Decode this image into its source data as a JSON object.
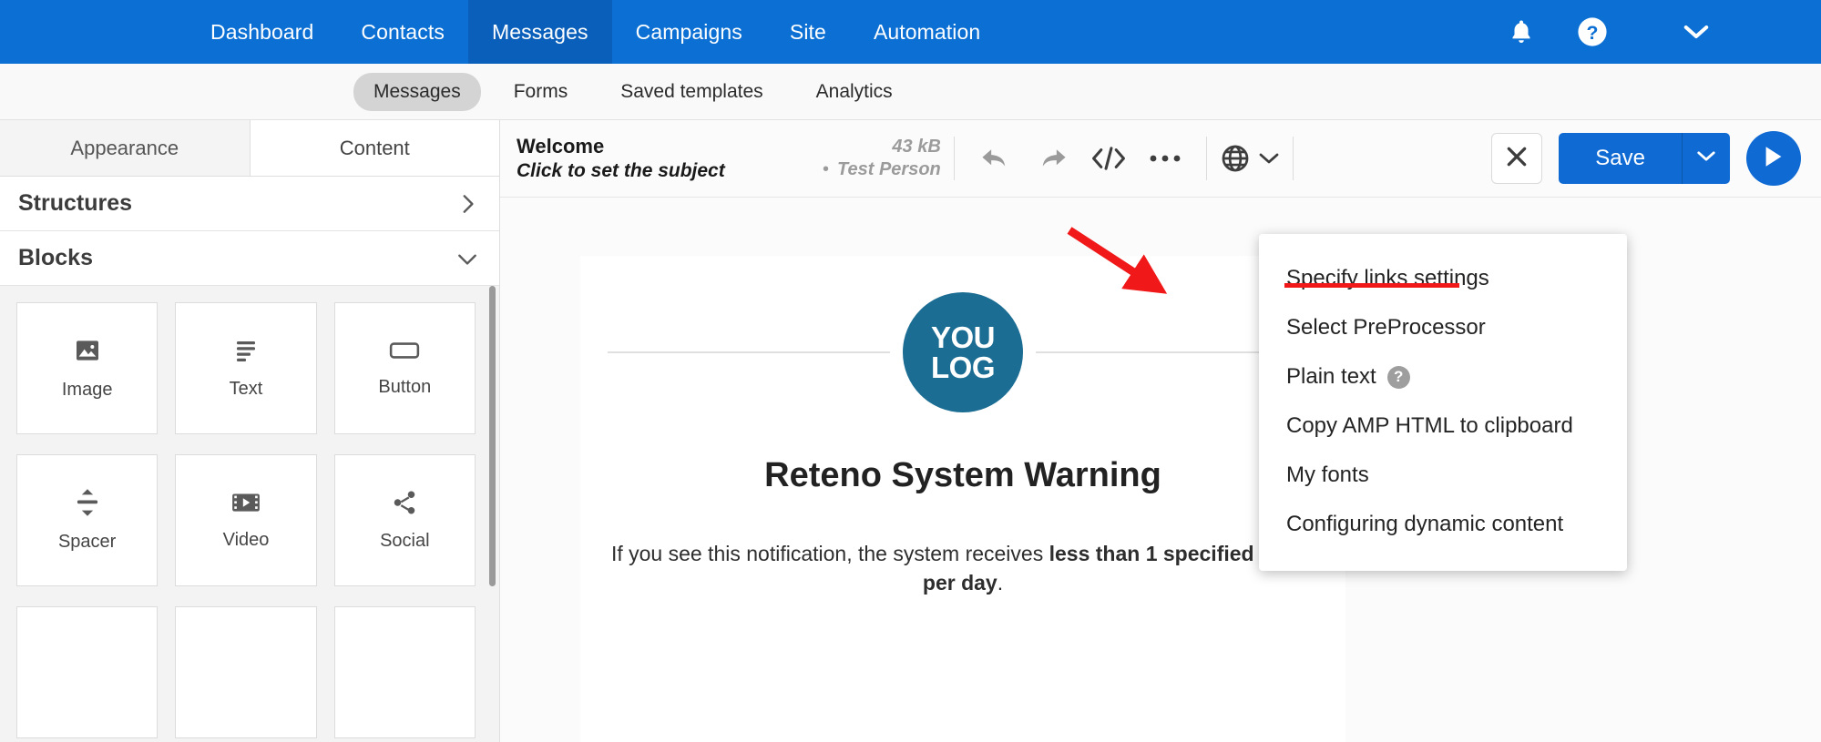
{
  "topnav": {
    "items": [
      {
        "label": "Dashboard",
        "active": false
      },
      {
        "label": "Contacts",
        "active": false
      },
      {
        "label": "Messages",
        "active": true
      },
      {
        "label": "Campaigns",
        "active": false
      },
      {
        "label": "Site",
        "active": false
      },
      {
        "label": "Automation",
        "active": false
      }
    ],
    "icons": {
      "bell": "bell-icon",
      "help": "help-circle-icon",
      "account_caret": "chevron-down-icon"
    },
    "accent_color": "#0b6fd4",
    "active_color": "#0a5fba"
  },
  "subnav": {
    "items": [
      {
        "label": "Messages",
        "active": true
      },
      {
        "label": "Forms",
        "active": false
      },
      {
        "label": "Saved templates",
        "active": false
      },
      {
        "label": "Analytics",
        "active": false
      }
    ]
  },
  "sidebar": {
    "tabs": [
      {
        "label": "Appearance",
        "active": false
      },
      {
        "label": "Content",
        "active": true
      }
    ],
    "sections": [
      {
        "label": "Structures",
        "expanded": false,
        "chevron": "chevron-right-icon"
      },
      {
        "label": "Blocks",
        "expanded": true,
        "chevron": "chevron-down-icon"
      }
    ],
    "blocks": [
      {
        "label": "Image",
        "icon": "image-icon"
      },
      {
        "label": "Text",
        "icon": "text-lines-icon"
      },
      {
        "label": "Button",
        "icon": "button-icon"
      },
      {
        "label": "Spacer",
        "icon": "spacer-arrows-icon"
      },
      {
        "label": "Video",
        "icon": "video-icon"
      },
      {
        "label": "Social",
        "icon": "share-icon"
      },
      {
        "label": "",
        "icon": ""
      },
      {
        "label": "",
        "icon": ""
      },
      {
        "label": "",
        "icon": ""
      }
    ]
  },
  "editor": {
    "subject_title": "Welcome",
    "subject_placeholder": "Click to set the subject",
    "size": "43 kB",
    "separator_dot": "•",
    "recipient": "Test Person",
    "toolbar": {
      "undo": "undo-arrow-icon",
      "redo": "redo-arrow-icon",
      "code": "code-brackets-icon",
      "more": "ellipsis-icon",
      "language": "globe-icon",
      "language_caret": "chevron-down-icon",
      "close_label": "close-icon",
      "save_label": "Save",
      "save_caret": "chevron-down-icon",
      "preview": "play-icon"
    }
  },
  "dropdown": {
    "items": [
      {
        "label": "Specify links settings",
        "highlighted": true,
        "help": false
      },
      {
        "label": "Select PreProcessor",
        "highlighted": false,
        "help": false
      },
      {
        "label": "Plain text",
        "highlighted": false,
        "help": true,
        "help_glyph": "?"
      },
      {
        "label": "Copy AMP HTML to clipboard",
        "highlighted": false,
        "help": false
      },
      {
        "label": "My fonts",
        "highlighted": false,
        "help": false
      },
      {
        "label": "Configuring dynamic content",
        "highlighted": false,
        "help": false
      }
    ],
    "annotation_color": "#f01818"
  },
  "email_preview": {
    "logo_line1": "YOU",
    "logo_line2": "LOG",
    "logo_color": "#1b6d93",
    "title": "Reteno System Warning",
    "body_prefix": "If you see this notification, the system receives ",
    "body_bold": "less than 1 specified event per day",
    "body_suffix": "."
  }
}
